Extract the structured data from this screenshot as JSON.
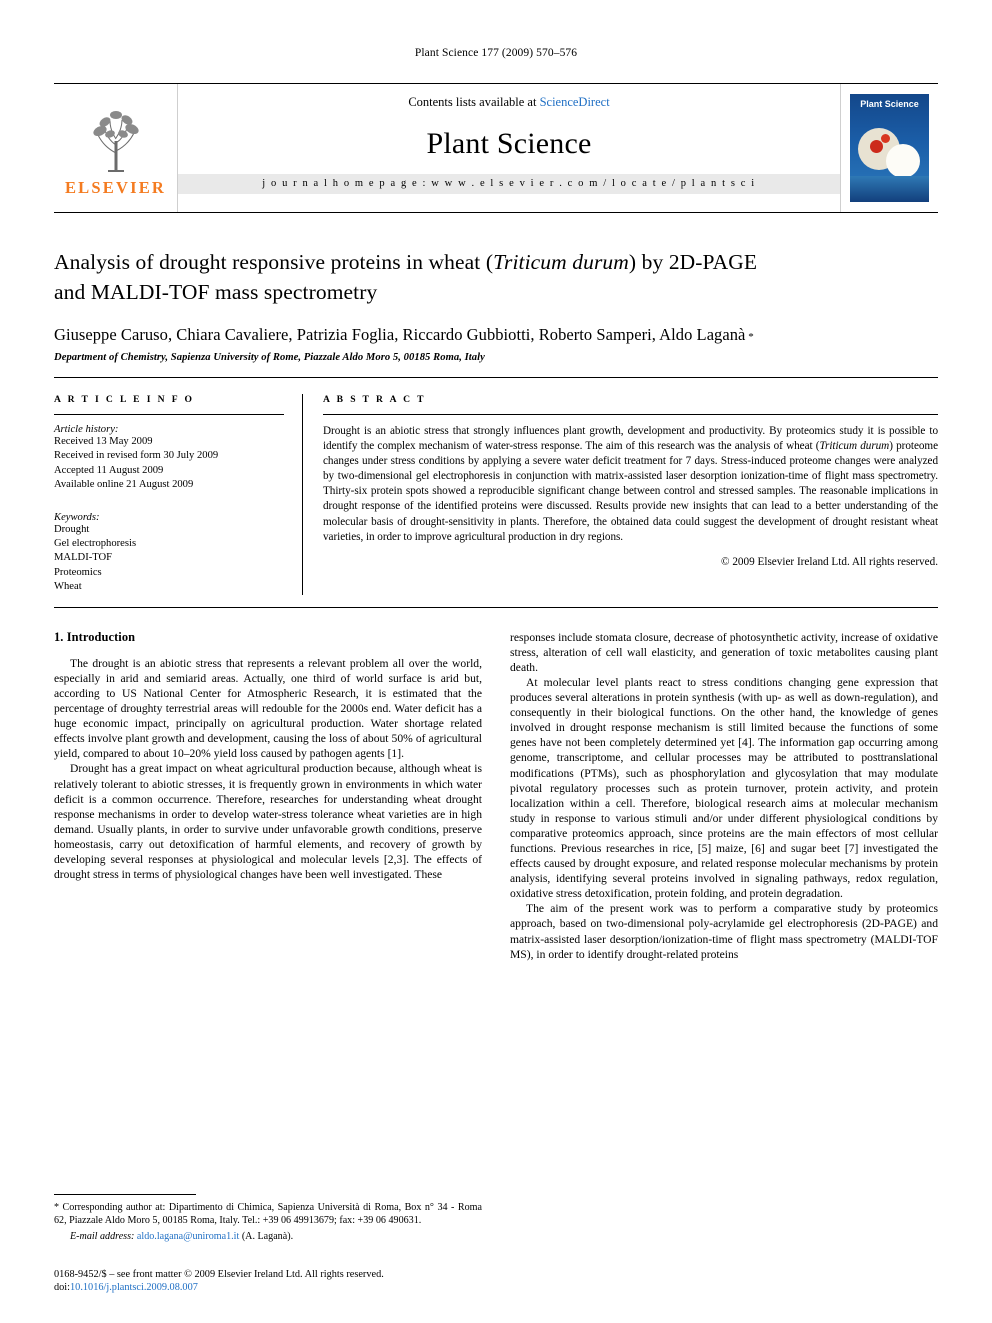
{
  "running_head": "Plant Science 177 (2009) 570–576",
  "masthead": {
    "contents_prefix": "Contents lists available at ",
    "contents_link": "ScienceDirect",
    "journal_title": "Plant Science",
    "homepage": "j o u r n a l   h o m e p a g e :   w w w . e l s e v i e r . c o m / l o c a t e / p l a n t s c i",
    "publisher": "ELSEVIER",
    "cover_title": "Plant Science"
  },
  "article": {
    "title_line1": "Analysis of drought responsive proteins in wheat (Triticum durum) by 2D-PAGE",
    "title_line2": "and MALDI-TOF mass spectrometry",
    "title_italic": "Triticum durum",
    "authors": "Giuseppe Caruso, Chiara Cavaliere, Patrizia Foglia, Riccardo Gubbiotti, Roberto Samperi, Aldo Laganà",
    "affiliation": "Department of Chemistry, Sapienza University of Rome, Piazzale Aldo Moro 5, 00185 Roma, Italy"
  },
  "article_info": {
    "heading": "A R T I C L E   I N F O",
    "history_title": "Article history:",
    "history": [
      "Received 13 May 2009",
      "Received in revised form 30 July 2009",
      "Accepted 11 August 2009",
      "Available online 21 August 2009"
    ],
    "keywords_title": "Keywords:",
    "keywords": [
      "Drought",
      "Gel electrophoresis",
      "MALDI-TOF",
      "Proteomics",
      "Wheat"
    ]
  },
  "abstract": {
    "heading": "A B S T R A C T",
    "text": "Drought is an abiotic stress that strongly influences plant growth, development and productivity. By proteomics study it is possible to identify the complex mechanism of water-stress response. The aim of this research was the analysis of wheat (Triticum durum) proteome changes under stress conditions by applying a severe water deficit treatment for 7 days. Stress-induced proteome changes were analyzed by two-dimensional gel electrophoresis in conjunction with matrix-assisted laser desorption ionization-time of flight mass spectrometry. Thirty-six protein spots showed a reproducible significant change between control and stressed samples. The reasonable implications in drought response of the identified proteins were discussed. Results provide new insights that can lead to a better understanding of the molecular basis of drought-sensitivity in plants. Therefore, the obtained data could suggest the development of drought resistant wheat varieties, in order to improve agricultural production in dry regions.",
    "copyright": "© 2009 Elsevier Ireland Ltd. All rights reserved."
  },
  "body": {
    "section_title": "1. Introduction",
    "left_paragraphs": [
      "The drought is an abiotic stress that represents a relevant problem all over the world, especially in arid and semiarid areas. Actually, one third of world surface is arid but, according to US National Center for Atmospheric Research, it is estimated that the percentage of droughty terrestrial areas will redouble for the 2000s end. Water deficit has a huge economic impact, principally on agricultural production. Water shortage related effects involve plant growth and development, causing the loss of about 50% of agricultural yield, compared to about 10–20% yield loss caused by pathogen agents [1].",
      "Drought has a great impact on wheat agricultural production because, although wheat is relatively tolerant to abiotic stresses, it is frequently grown in environments in which water deficit is a common occurrence. Therefore, researches for understanding wheat drought response mechanisms in order to develop water-stress tolerance wheat varieties are in high demand. Usually plants, in order to survive under unfavorable growth conditions, preserve homeostasis, carry out detoxification of harmful elements, and recovery of growth by developing several responses at physiological and molecular levels [2,3]. The effects of drought stress in terms of physiological changes have been well investigated. These"
    ],
    "right_paragraphs": [
      "responses include stomata closure, decrease of photosynthetic activity, increase of oxidative stress, alteration of cell wall elasticity, and generation of toxic metabolites causing plant death.",
      "At molecular level plants react to stress conditions changing gene expression that produces several alterations in protein synthesis (with up- as well as down-regulation), and consequently in their biological functions. On the other hand, the knowledge of genes involved in drought response mechanism is still limited because the functions of some genes have not been completely determined yet [4]. The information gap occurring among genome, transcriptome, and cellular processes may be attributed to posttranslational modifications (PTMs), such as phosphorylation and glycosylation that may modulate pivotal regulatory processes such as protein turnover, protein activity, and protein localization within a cell. Therefore, biological research aims at molecular mechanism study in response to various stimuli and/or under different physiological conditions by comparative proteomics approach, since proteins are the main effectors of most cellular functions. Previous researches in rice, [5] maize, [6] and sugar beet [7] investigated the effects caused by drought exposure, and related response molecular mechanisms by protein analysis, identifying several proteins involved in signaling pathways, redox regulation, oxidative stress detoxification, protein folding, and protein degradation.",
      "The aim of the present work was to perform a comparative study by proteomics approach, based on two-dimensional poly-acrylamide gel electrophoresis (2D-PAGE) and matrix-assisted laser desorption/ionization-time of flight mass spectrometry (MALDI-TOF MS), in order to identify drought-related proteins"
    ]
  },
  "footnote": {
    "marker": "*",
    "text": "Corresponding author at: Dipartimento di Chimica, Sapienza Università di Roma, Box n° 34 - Roma 62, Piazzale Aldo Moro 5, 00185 Roma, Italy. Tel.: +39 06 49913679; fax: +39 06 490631.",
    "email_label": "E-mail address:",
    "email": "aldo.lagana@uniroma1.it",
    "email_suffix": "(A. Laganà)."
  },
  "footer": {
    "line1": "0168-9452/$ – see front matter © 2009 Elsevier Ireland Ltd. All rights reserved.",
    "line2_prefix": "doi:",
    "line2_link": "10.1016/j.plantsci.2009.08.007"
  },
  "colors": {
    "link_blue": "#1f6fc4",
    "elsevier_orange": "#F47B20",
    "bar_gray": "#e9e9e9"
  }
}
